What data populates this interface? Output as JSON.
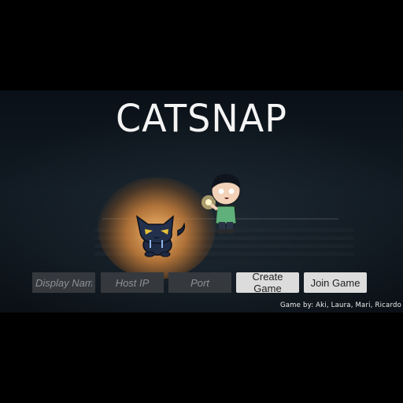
{
  "game": {
    "title": "CATSNAP",
    "credits": "Game by: Aki, Laura, Mari, Ricardo"
  },
  "lobby": {
    "display_name_placeholder": "Display Name",
    "host_ip_placeholder": "Host IP",
    "port_placeholder": "Port",
    "create_game_label": "Create Game",
    "join_game_label": "Join Game"
  },
  "colors": {
    "background": "#0b1118",
    "flashlight": "#f0a860",
    "cat": "#1f2a44",
    "cat_eyes": "#e6c23a",
    "boy_shirt": "#5fb07a"
  },
  "sprites": {
    "cat": "cat-character",
    "boy": "boy-with-flashlight-character"
  }
}
